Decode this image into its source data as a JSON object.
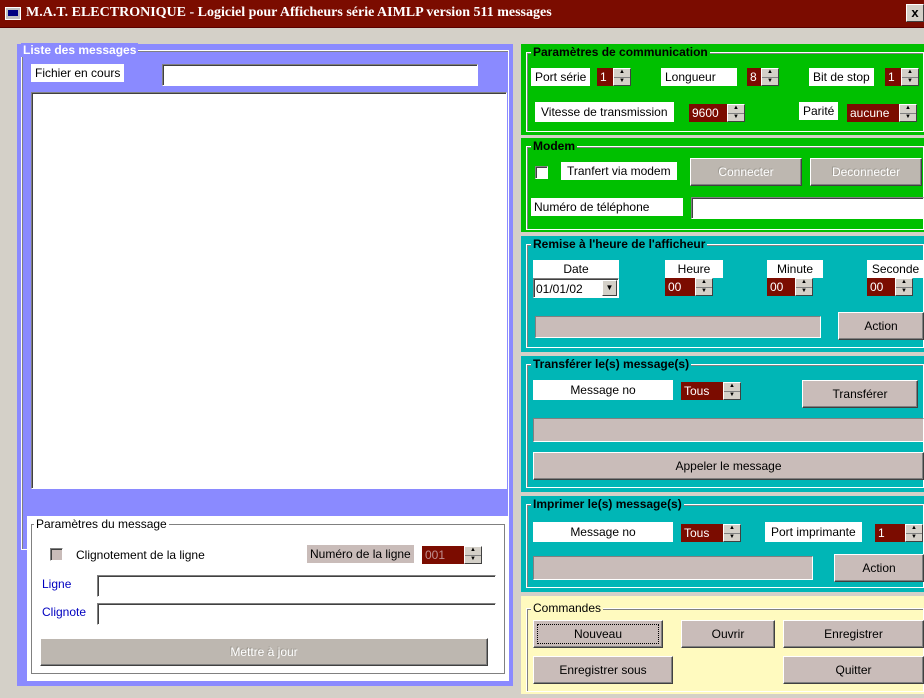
{
  "window": {
    "title": "M.A.T. ELECTRONIQUE - Logiciel pour Afficheurs série AIMLP version 511 messages",
    "close_label": "x"
  },
  "colors": {
    "titlebar": "#7b0c00",
    "left_panel": "#8a8aff",
    "comm": "#00c000",
    "teal": "#00b6b6",
    "commands": "#fffabf",
    "spin_value_bg": "#7b0c00"
  },
  "messages": {
    "legend": "Liste des messages",
    "file_label": "Fichier en cours",
    "file_value": ""
  },
  "msg_params": {
    "legend": "Paramètres du message",
    "blink_label": "Clignotement de la ligne",
    "line_number_label": "Numéro de la ligne",
    "line_number_value": "001",
    "line_label": "Ligne",
    "line_value": "",
    "blink_field_label": "Clignote",
    "blink_field_value": "",
    "update_button": "Mettre à jour"
  },
  "comm": {
    "legend": "Paramètres de communication",
    "port_label": "Port série",
    "port_value": "1",
    "length_label": "Longueur",
    "length_value": "8",
    "stopbit_label": "Bit de stop",
    "stopbit_value": "1",
    "speed_label": "Vitesse de transmission",
    "speed_value": "9600",
    "parity_label": "Parité",
    "parity_value": "aucune"
  },
  "modem": {
    "legend": "Modem",
    "transfer_label": "Tranfert via modem",
    "connect_button": "Connecter",
    "disconnect_button": "Deconnecter",
    "phone_label": "Numéro de téléphone",
    "phone_value": ""
  },
  "clock": {
    "legend": "Remise à l'heure de l'afficheur",
    "date_label": "Date",
    "date_value": "01/01/02",
    "hour_label": "Heure",
    "hour_value": "00",
    "minute_label": "Minute",
    "minute_value": "00",
    "second_label": "Seconde",
    "second_value": "00",
    "action_button": "Action"
  },
  "transfer": {
    "legend": "Transférer le(s) message(s)",
    "message_no_label": "Message no",
    "message_no_value": "Tous",
    "transfer_button": "Transférer",
    "call_button": "Appeler le  message"
  },
  "print": {
    "legend": "Imprimer le(s) message(s)",
    "message_no_label": "Message no",
    "message_no_value": "Tous",
    "printer_port_label": "Port imprimante",
    "printer_port_value": "1",
    "action_button": "Action"
  },
  "commands": {
    "legend": "Commandes",
    "new_button": "Nouveau",
    "open_button": "Ouvrir",
    "save_button": "Enregistrer",
    "save_as_button": "Enregistrer sous",
    "quit_button": "Quitter"
  }
}
